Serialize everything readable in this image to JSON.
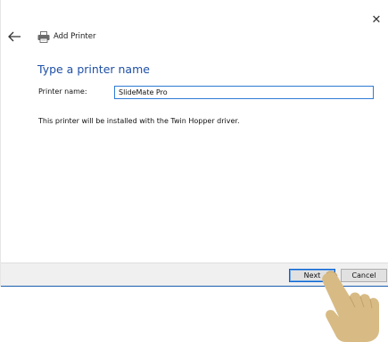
{
  "window": {
    "title": "Add Printer",
    "close_glyph": "✕"
  },
  "icons": {
    "back": "back-arrow-icon",
    "printer": "printer-icon",
    "close": "close-icon"
  },
  "main": {
    "heading": "Type a printer name",
    "printer_name_label": "Printer name:",
    "printer_name_value": "SlideMate Pro",
    "info": "This printer will be installed with the Twin Hopper driver."
  },
  "footer": {
    "next_label": "Next",
    "cancel_label": "Cancel"
  },
  "colors": {
    "accent": "#1e4fa6",
    "input_border": "#2f7bd4",
    "footer_bg": "#f0f0f0",
    "hand": "#d8bb84"
  }
}
